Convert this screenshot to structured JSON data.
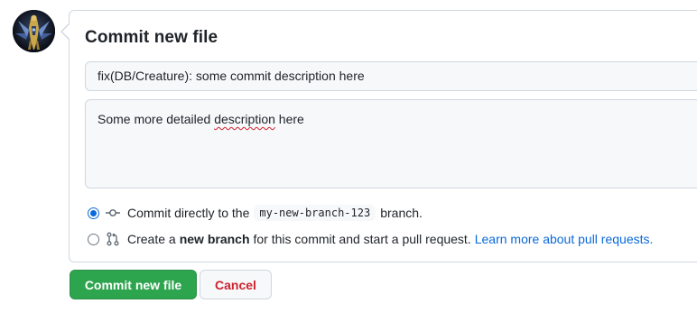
{
  "avatar": {
    "icon": "armored-hero-avatar"
  },
  "commit_form": {
    "title": "Commit new file",
    "summary_value": "fix(DB/Creature): some commit description here",
    "description": {
      "before": "Some more detailed ",
      "misspelled": "description",
      "after": " here"
    },
    "option_direct": {
      "text_before": "Commit directly to the",
      "branch_name": "my-new-branch-123",
      "text_after": "branch.",
      "selected": true,
      "icon": "git-commit-icon"
    },
    "option_new_branch": {
      "text_before": "Create a",
      "bold_text": "new branch",
      "text_after": "for this commit and start a pull request.",
      "link_text": "Learn more about pull requests.",
      "selected": false,
      "icon": "git-pull-request-icon"
    }
  },
  "buttons": {
    "commit_label": "Commit new file",
    "cancel_label": "Cancel"
  },
  "colors": {
    "primary_green": "#2da44e",
    "danger_red": "#cf222e",
    "link_blue": "#0969da",
    "border": "#d0d7de"
  }
}
